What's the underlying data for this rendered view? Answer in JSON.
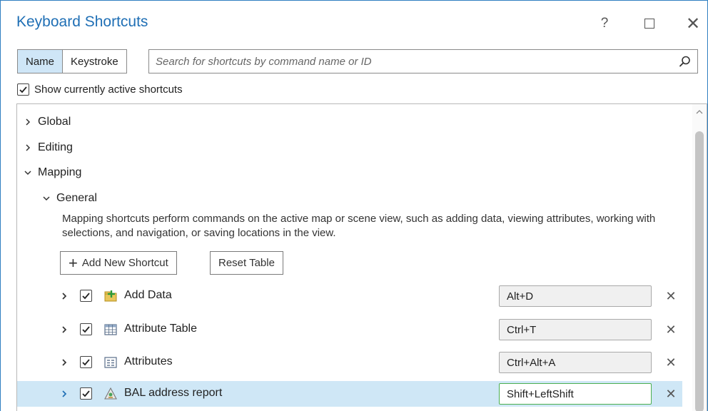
{
  "window": {
    "title": "Keyboard Shortcuts",
    "help_label": "?"
  },
  "search": {
    "mode_name": "Name",
    "mode_keystroke": "Keystroke",
    "placeholder": "Search for shortcuts by command name or ID",
    "value": ""
  },
  "show_active": {
    "label": "Show currently active shortcuts",
    "checked": true
  },
  "tree": {
    "global": "Global",
    "editing": "Editing",
    "mapping": "Mapping",
    "general": "General",
    "description": "Mapping shortcuts perform commands on the active map or scene view, such as adding data, viewing attributes, working with selections, and navigation, or saving locations in the view.",
    "add_button": "Add New Shortcut",
    "reset_button": "Reset Table"
  },
  "shortcuts": [
    {
      "name": "Add Data",
      "key": "Alt+D",
      "icon": "add-data-icon",
      "checked": true,
      "selected": false
    },
    {
      "name": "Attribute Table",
      "key": "Ctrl+T",
      "icon": "attribute-table-icon",
      "checked": true,
      "selected": false
    },
    {
      "name": "Attributes",
      "key": "Ctrl+Alt+A",
      "icon": "attributes-icon",
      "checked": true,
      "selected": false
    },
    {
      "name": "BAL address report",
      "key": "Shift+LeftShift",
      "icon": "report-tool-icon",
      "checked": true,
      "selected": true
    }
  ],
  "colors": {
    "accent": "#1f6fb5",
    "selected_row": "#cfe7f6",
    "active_tab": "#cfe6f7",
    "focus_border": "#4caf50"
  }
}
